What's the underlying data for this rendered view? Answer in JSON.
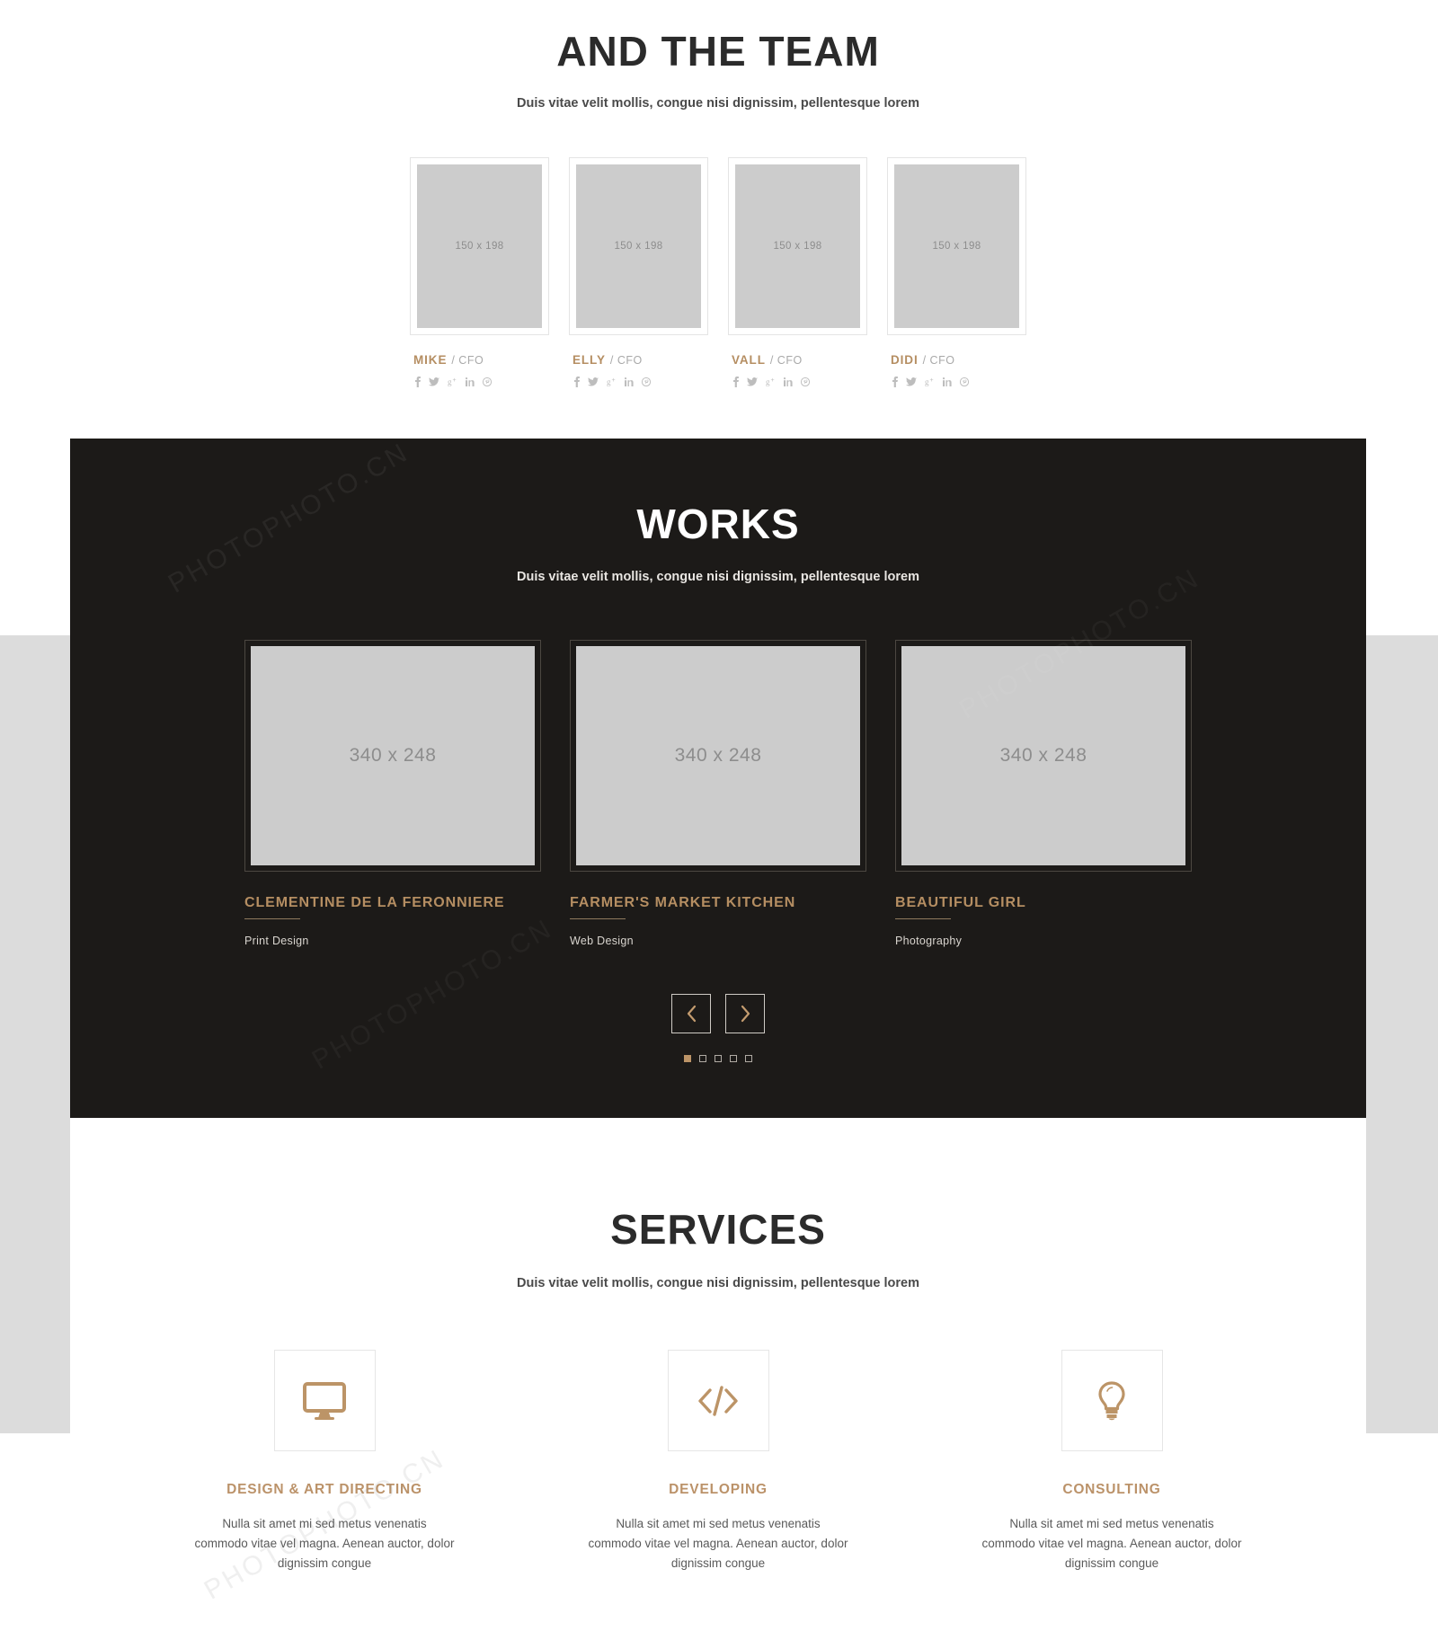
{
  "team": {
    "title": "AND THE TEAM",
    "subtitle": "Duis vitae velit mollis, congue nisi dignissim, pellentesque lorem",
    "placeholder_label": "150 x 198",
    "role_separator": "/",
    "members": [
      {
        "name": "MIKE",
        "role": "/ CFO"
      },
      {
        "name": "ELLY",
        "role": "/ CFO"
      },
      {
        "name": "VALL",
        "role": "/ CFO"
      },
      {
        "name": "DIDI",
        "role": "/ CFO"
      }
    ],
    "social_icons": [
      "facebook-icon",
      "twitter-icon",
      "google-plus-icon",
      "linkedin-icon",
      "pinterest-icon"
    ]
  },
  "works": {
    "title": "WORKS",
    "subtitle": "Duis vitae velit mollis, congue nisi dignissim, pellentesque lorem",
    "placeholder_label": "340 x 248",
    "items": [
      {
        "title": "CLEMENTINE DE LA FERONNIERE",
        "category": "Print Design"
      },
      {
        "title": "FARMER'S MARKET KITCHEN",
        "category": "Web Design"
      },
      {
        "title": "BEAUTIFUL GIRL",
        "category": "Photography"
      }
    ],
    "prev_label": "‹",
    "next_label": "›",
    "dots_count": 5,
    "active_dot": 1
  },
  "services": {
    "title": "SERVICES",
    "subtitle": "Duis vitae velit mollis, congue nisi dignissim, pellentesque lorem",
    "items": [
      {
        "icon": "monitor-icon",
        "title": "DESIGN & ART DIRECTING",
        "body": "Nulla sit amet mi sed metus venenatis commodo vitae vel magna. Aenean auctor, dolor dignissim congue"
      },
      {
        "icon": "code-icon",
        "title": "DEVELOPING",
        "body": "Nulla sit amet mi sed metus venenatis commodo vitae vel magna. Aenean auctor, dolor dignissim congue"
      },
      {
        "icon": "lightbulb-icon",
        "title": "CONSULTING",
        "body": "Nulla sit amet mi sed metus venenatis commodo vitae vel magna. Aenean auctor, dolor dignissim congue"
      }
    ]
  },
  "colors": {
    "accent": "#b58e62",
    "dark_bg": "#1c1a18",
    "placeholder_gray": "#cccccc",
    "side_band": "#dcdcdc"
  },
  "watermark": {
    "text": "PHOTOPHOTO.CN"
  }
}
